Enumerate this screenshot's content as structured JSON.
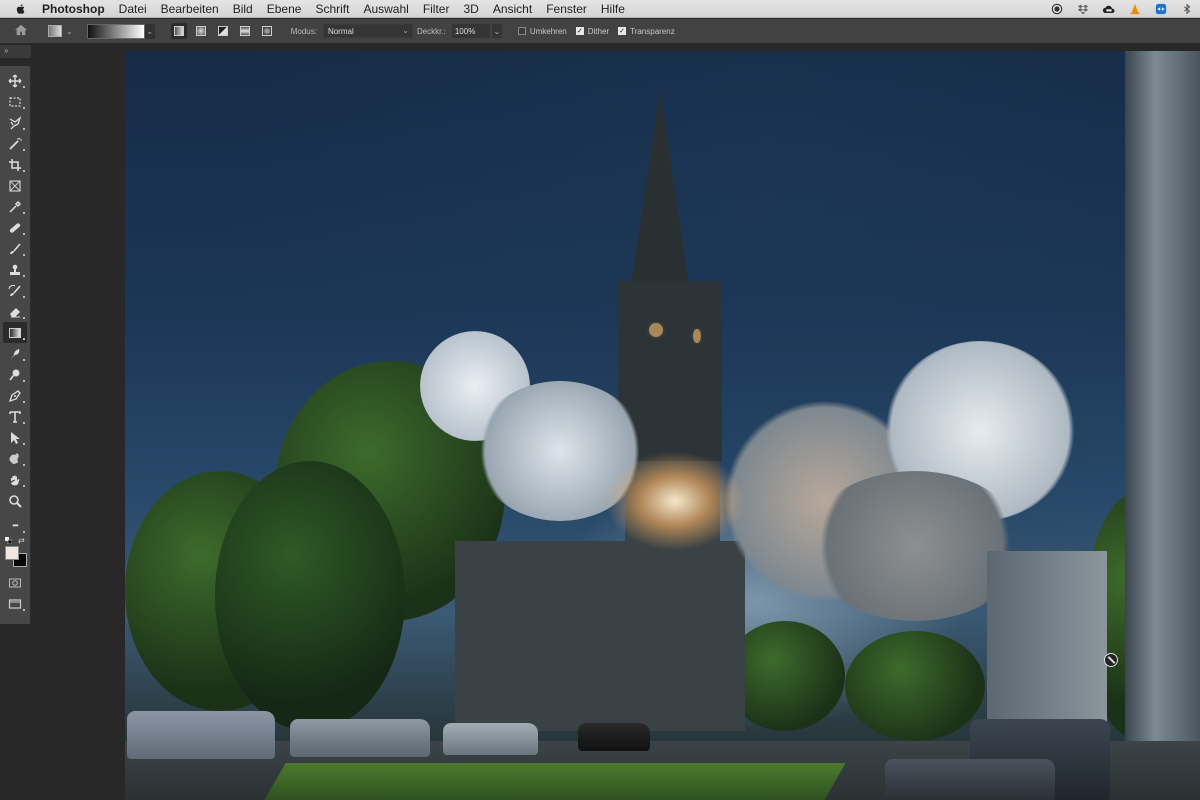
{
  "menubar": {
    "app_name": "Photoshop",
    "items": [
      "Datei",
      "Bearbeiten",
      "Bild",
      "Ebene",
      "Schrift",
      "Auswahl",
      "Filter",
      "3D",
      "Ansicht",
      "Fenster",
      "Hilfe"
    ],
    "status_icons": [
      "record-icon",
      "dropbox-icon",
      "creative-cloud-icon",
      "vlc-icon",
      "teamviewer-icon",
      "bluetooth-icon"
    ]
  },
  "options_bar": {
    "tool": "gradient-tool",
    "gradient_types": [
      "linear",
      "radial",
      "angle",
      "reflected",
      "diamond"
    ],
    "active_gradient_type": "linear",
    "mode_label": "Modus:",
    "mode_value": "Normal",
    "opacity_label": "Deckkr.:",
    "opacity_value": "100%",
    "checkboxes": [
      {
        "label": "Umkehren",
        "checked": false
      },
      {
        "label": "Dither",
        "checked": true
      },
      {
        "label": "Transparenz",
        "checked": true
      }
    ]
  },
  "panel_collapse_glyph": "»",
  "toolbar": {
    "tools": [
      "move",
      "rectangular-marquee",
      "lasso",
      "magic-wand",
      "crop",
      "frame",
      "eyedropper",
      "healing-brush",
      "brush",
      "clone-stamp",
      "history-brush",
      "eraser",
      "gradient",
      "smudge",
      "dodge",
      "pen",
      "type",
      "path-selection",
      "custom-shape",
      "hand",
      "zoom",
      "edit-toolbar"
    ],
    "active_tool": "gradient",
    "foreground_color": "#f3e6dc",
    "background_color": "#080808",
    "more_glyph": "•••"
  },
  "canvas": {
    "description": "Composite image: church spire launching like a rocket with clouds of smoke over a city street at dusk"
  }
}
